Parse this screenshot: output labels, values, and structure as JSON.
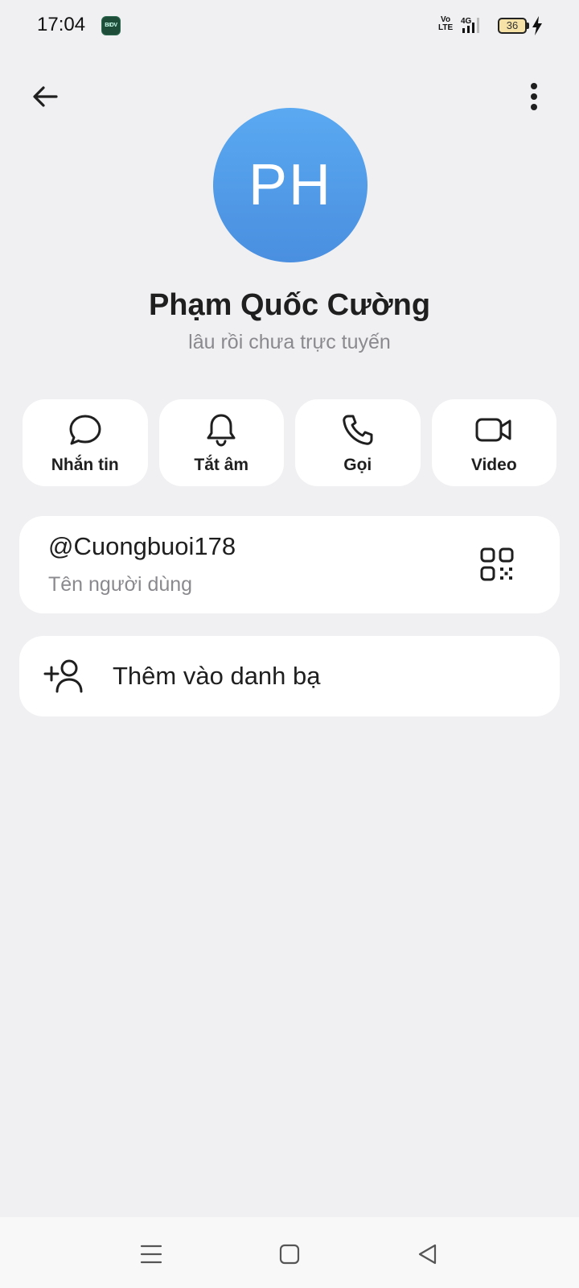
{
  "status_bar": {
    "time": "17:04",
    "notification_app_icon": "bidv-app-icon",
    "network_volte_top": "Vo",
    "network_volte_bottom": "LTE",
    "network_type": "4G",
    "battery_level": "36",
    "charging": true
  },
  "header": {
    "back_icon": "arrow-left-icon",
    "more_icon": "more-vertical-icon"
  },
  "profile": {
    "avatar_initials": "PH",
    "avatar_color": "#4f9ae8",
    "name": "Phạm Quốc Cường",
    "status": "lâu rồi chưa trực tuyến"
  },
  "actions": [
    {
      "label": "Nhắn tin",
      "icon": "chat-bubble-icon"
    },
    {
      "label": "Tắt âm",
      "icon": "bell-icon"
    },
    {
      "label": "Gọi",
      "icon": "phone-icon"
    },
    {
      "label": "Video",
      "icon": "video-camera-icon"
    }
  ],
  "username_card": {
    "username": "@Cuongbuoi178",
    "caption": "Tên người dùng",
    "qr_icon": "qr-code-icon"
  },
  "add_contact": {
    "label": "Thêm vào danh bạ",
    "icon": "add-user-icon"
  },
  "nav_bar": {
    "menu_icon": "menu-icon",
    "home_icon": "home-square-icon",
    "back_icon": "back-triangle-icon"
  },
  "colors": {
    "background": "#f0f0f3",
    "card": "#ffffff",
    "text_primary": "#1f1f1f",
    "text_secondary": "#8a8a8e"
  }
}
